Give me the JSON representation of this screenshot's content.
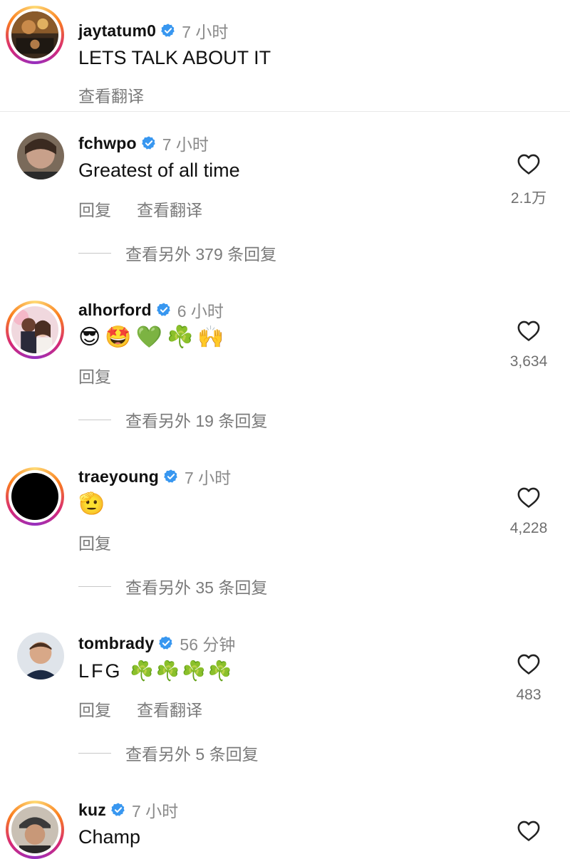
{
  "post": {
    "username": "jaytatum0",
    "time": "7 小时",
    "caption": "LETS TALK ABOUT IT",
    "translate_label": "查看翻译"
  },
  "comments": [
    {
      "username": "fchwpo",
      "time": "7 小时",
      "text": "Greatest of all time",
      "reply_label": "回复",
      "translate_label": "查看翻译",
      "view_replies": "查看另外 379 条回复",
      "likes": "2.1万"
    },
    {
      "username": "alhorford",
      "time": "6 小时",
      "text": "😎🤩💚☘️🙌",
      "reply_label": "回复",
      "view_replies": "查看另外 19 条回复",
      "likes": "3,634"
    },
    {
      "username": "traeyoung",
      "time": "7 小时",
      "text": "🫡",
      "reply_label": "回复",
      "view_replies": "查看另外 35 条回复",
      "likes": "4,228"
    },
    {
      "username": "tombrady",
      "time": "56 分钟",
      "text": "LFG ☘️☘️☘️☘️",
      "reply_label": "回复",
      "translate_label": "查看翻译",
      "view_replies": "查看另外 5 条回复",
      "likes": "483"
    },
    {
      "username": "kuz",
      "time": "7 小时",
      "text": "Champ"
    }
  ],
  "icons": {
    "verified": "verified-badge-icon",
    "like": "heart-outline-icon"
  },
  "colors": {
    "verified_blue": "#3897f0",
    "muted_text": "#8a8a8a",
    "story_ring": "#d62976"
  }
}
